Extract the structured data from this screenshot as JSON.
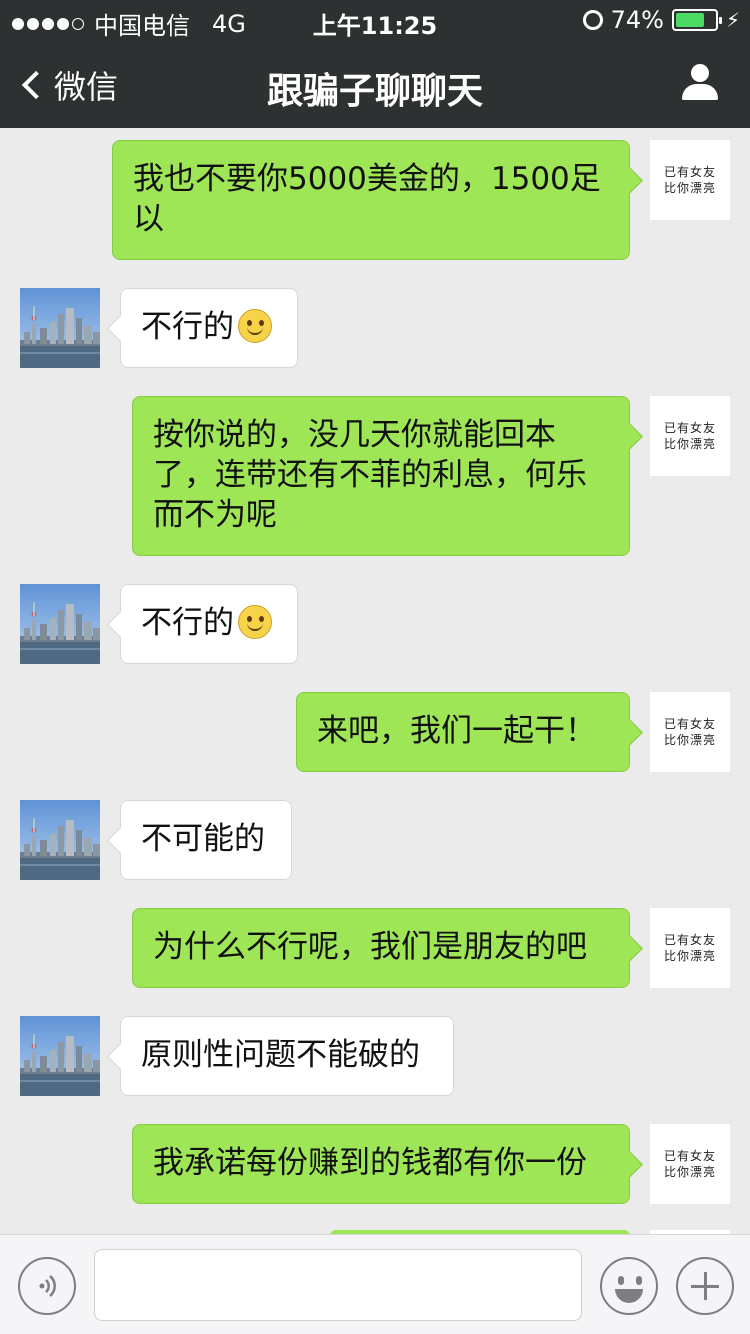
{
  "status_bar": {
    "carrier": "中国电信",
    "network": "4G",
    "time": "上午11:25",
    "battery": "74%",
    "battery_level": 0.74,
    "signal_dots": 4
  },
  "nav": {
    "back_label": "微信",
    "title": "跟骗子聊聊天"
  },
  "my_avatar_text": [
    "已有女友",
    "比你漂亮"
  ],
  "messages": [
    {
      "from": "me",
      "text": "我也不要你5000美金的，1500足以",
      "lines": [
        "我也不要你5000美金的，1500足",
        "以"
      ]
    },
    {
      "from": "other",
      "text": "不行的",
      "emoji": "smile"
    },
    {
      "from": "me",
      "text": "按你说的，没几天你就能回本了，连带还有不菲的利息，何乐而不为呢",
      "lines": [
        "按你说的，没几天你就能回本",
        "了，连带还有不菲的利息，何乐",
        "而不为呢"
      ]
    },
    {
      "from": "other",
      "text": "不行的",
      "emoji": "smile"
    },
    {
      "from": "me",
      "text": "来吧，我们一起干！",
      "lines": [
        "来吧，我们一起干！"
      ]
    },
    {
      "from": "other",
      "text": "不可能的"
    },
    {
      "from": "me",
      "text": "为什么不行呢，我们是朋友的吧",
      "lines": [
        "为什么不行呢，我们是朋友的吧"
      ]
    },
    {
      "from": "other",
      "text": "原则性问题不能破的"
    },
    {
      "from": "me",
      "text": "我承诺每份赚到的钱都有你一份",
      "lines": [
        "我承诺每份赚到的钱都有你一份"
      ]
    }
  ],
  "input_bar": {
    "voice_icon": "voice-icon",
    "emoji_icon": "emoji-icon",
    "plus_icon": "plus-icon"
  },
  "colors": {
    "nav_bg": "#2e3132",
    "chat_bg": "#ebebeb",
    "my_bubble": "#9fe657",
    "other_bubble": "#ffffff"
  }
}
